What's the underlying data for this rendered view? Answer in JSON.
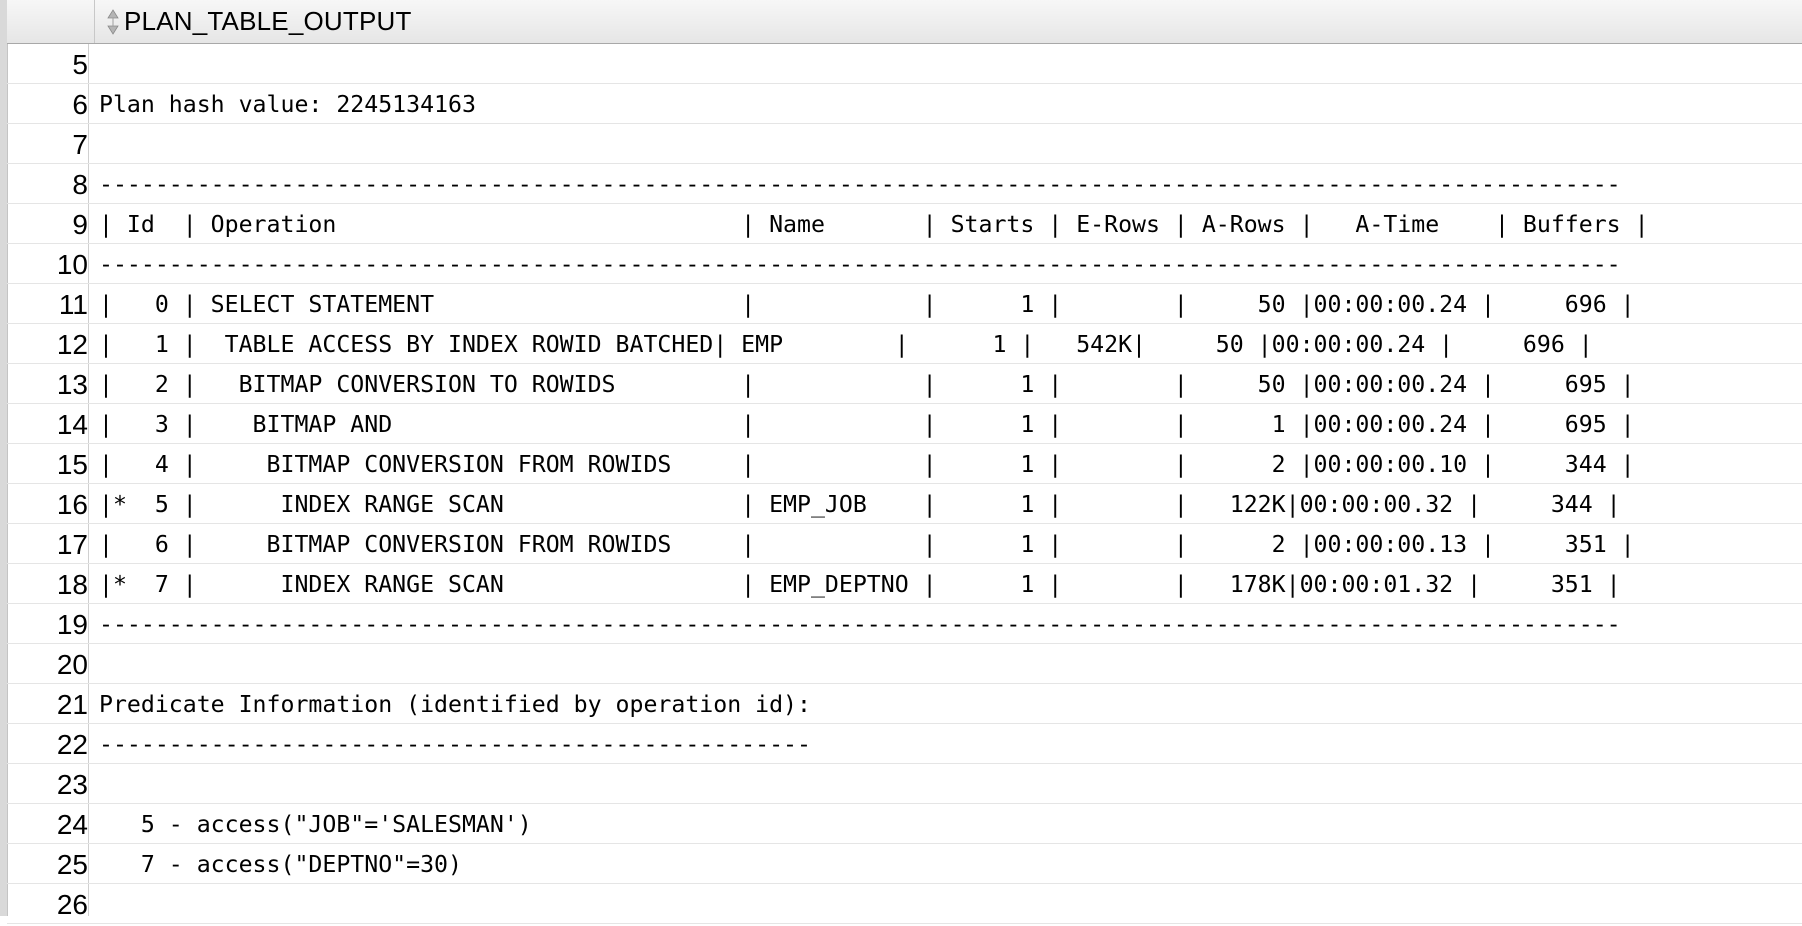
{
  "column_header": "PLAN_TABLE_OUTPUT",
  "rows": [
    {
      "num": "5",
      "text": ""
    },
    {
      "num": "6",
      "text": "Plan hash value: 2245134163"
    },
    {
      "num": "7",
      "text": ""
    },
    {
      "num": "8",
      "text": "-------------------------------------------------------------------------------------------------------------"
    },
    {
      "num": "9",
      "text": "| Id  | Operation                             | Name       | Starts | E-Rows | A-Rows |   A-Time    | Buffers |"
    },
    {
      "num": "10",
      "text": "-------------------------------------------------------------------------------------------------------------"
    },
    {
      "num": "11",
      "text": "|   0 | SELECT STATEMENT                      |            |      1 |        |     50 |00:00:00.24 |     696 |"
    },
    {
      "num": "12",
      "text": "|   1 |  TABLE ACCESS BY INDEX ROWID BATCHED| EMP        |      1 |   542K|     50 |00:00:00.24 |     696 |"
    },
    {
      "num": "13",
      "text": "|   2 |   BITMAP CONVERSION TO ROWIDS         |            |      1 |        |     50 |00:00:00.24 |     695 |"
    },
    {
      "num": "14",
      "text": "|   3 |    BITMAP AND                         |            |      1 |        |      1 |00:00:00.24 |     695 |"
    },
    {
      "num": "15",
      "text": "|   4 |     BITMAP CONVERSION FROM ROWIDS     |            |      1 |        |      2 |00:00:00.10 |     344 |"
    },
    {
      "num": "16",
      "text": "|*  5 |      INDEX RANGE SCAN                 | EMP_JOB    |      1 |        |   122K|00:00:00.32 |     344 |"
    },
    {
      "num": "17",
      "text": "|   6 |     BITMAP CONVERSION FROM ROWIDS     |            |      1 |        |      2 |00:00:00.13 |     351 |"
    },
    {
      "num": "18",
      "text": "|*  7 |      INDEX RANGE SCAN                 | EMP_DEPTNO |      1 |        |   178K|00:00:01.32 |     351 |"
    },
    {
      "num": "19",
      "text": "-------------------------------------------------------------------------------------------------------------"
    },
    {
      "num": "20",
      "text": ""
    },
    {
      "num": "21",
      "text": "Predicate Information (identified by operation id):"
    },
    {
      "num": "22",
      "text": "---------------------------------------------------"
    },
    {
      "num": "23",
      "text": ""
    },
    {
      "num": "24",
      "text": "   5 - access(\"JOB\"='SALESMAN')"
    },
    {
      "num": "25",
      "text": "   7 - access(\"DEPTNO\"=30)"
    },
    {
      "num": "26",
      "text": ""
    }
  ]
}
